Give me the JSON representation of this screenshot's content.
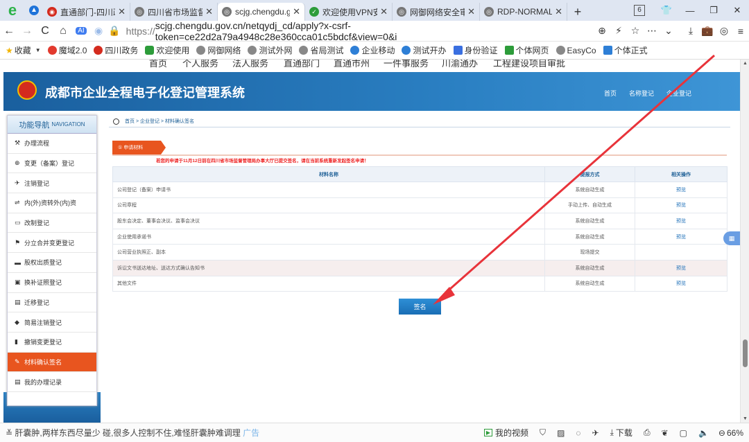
{
  "browser": {
    "tabs": [
      {
        "label": "直通部门-四川政",
        "active": false
      },
      {
        "label": "四川省市场监督管",
        "active": false
      },
      {
        "label": "scjg.chengdu.g",
        "active": true
      },
      {
        "label": "欢迎使用VPN安",
        "active": false
      },
      {
        "label": "网御网络安全审",
        "active": false
      },
      {
        "label": "RDP-NORMAL-",
        "active": false
      }
    ],
    "tab_count": "6",
    "url_scheme": "https://",
    "url_rest": "scjg.chengdu.gov.cn/netqydj_cd/apply?x-csrf-token=ce22d2a79a4948c28e360cca01c5bdcf&view=0&i",
    "bookmarks": [
      "收藏",
      "魔域2.0",
      "四川政务",
      "欢迎使用",
      "网御网络",
      "测试外网",
      "省局测试",
      "企业移动",
      "测试开办",
      "身份验证",
      "个体网页",
      "EasyCo",
      "个体正式"
    ]
  },
  "site": {
    "topnav": [
      "首页",
      "个人服务",
      "法人服务",
      "直通部门",
      "直通市州",
      "一件事服务",
      "川渝通办",
      "工程建设项目审批"
    ],
    "title": "成都市企业全程电子化登记管理系统",
    "header_links": [
      "首页",
      "名称登记",
      "企业登记"
    ]
  },
  "sidebar": {
    "heading": "功能导航",
    "heading_en": "NAVIGATION",
    "items": [
      {
        "label": "办理流程",
        "icon": "⚒"
      },
      {
        "label": "变更（备案）登记",
        "icon": "⊕"
      },
      {
        "label": "注销登记",
        "icon": "✈"
      },
      {
        "label": "内(外)资转外(内)资",
        "icon": "⇌"
      },
      {
        "label": "改制登记",
        "icon": "▭"
      },
      {
        "label": "分立合并变更登记",
        "icon": "⚑"
      },
      {
        "label": "股权出质登记",
        "icon": "▬"
      },
      {
        "label": "换补证照登记",
        "icon": "▣"
      },
      {
        "label": "迁移登记",
        "icon": "▤"
      },
      {
        "label": "简易注销登记",
        "icon": "◆"
      },
      {
        "label": "撤销变更登记",
        "icon": "▮"
      },
      {
        "label": "材料确认签名",
        "icon": "✎",
        "active": true
      },
      {
        "label": "我的办理记录",
        "icon": "▤"
      }
    ]
  },
  "breadcrumb": "首页 > 企业登记 > 材料确认签名",
  "section_tag": "① 申请材料",
  "warning": "若您的申请于11月12日前在四川省市场监督管理局办事大厅已提交签名，请在当前系统重新发起签名申请！",
  "table": {
    "headers": [
      "材料名称",
      "提报方式",
      "相关操作"
    ],
    "rows": [
      {
        "name": "公司登记（备案）申请书",
        "method": "系统自动生成",
        "action": "预览"
      },
      {
        "name": "公司章程",
        "method": "手动上传、自动生成",
        "action": "预览"
      },
      {
        "name": "股东会决定、董事会决议、监事会决议",
        "method": "系统自动生成",
        "action": "预览"
      },
      {
        "name": "企业使用承诺书",
        "method": "系统自动生成",
        "action": "预览"
      },
      {
        "name": "公司营业执照正、副本",
        "method": "现场提交",
        "action": ""
      },
      {
        "name": "诉讼文书送达地址、送达方式确认告知书",
        "method": "系统自动生成",
        "action": "预览",
        "highlight": true
      },
      {
        "name": "其他文件",
        "method": "系统自动生成",
        "action": "预览"
      }
    ]
  },
  "sign_button": "签名",
  "statusbar": {
    "news_a": "≚ 肝囊肿,两样东西尽量少 碰",
    "news_b": ",很多人控制不住,难怪肝囊肿难调理",
    "news_c": "广告",
    "my_video": "我的视频",
    "download": "下载",
    "zoom": "66%"
  },
  "colors": {
    "accent": "#e8551f",
    "brand_blue": "#1a5f9e",
    "link": "#1d6fb8",
    "annotation_arrow": "#e8333a"
  }
}
